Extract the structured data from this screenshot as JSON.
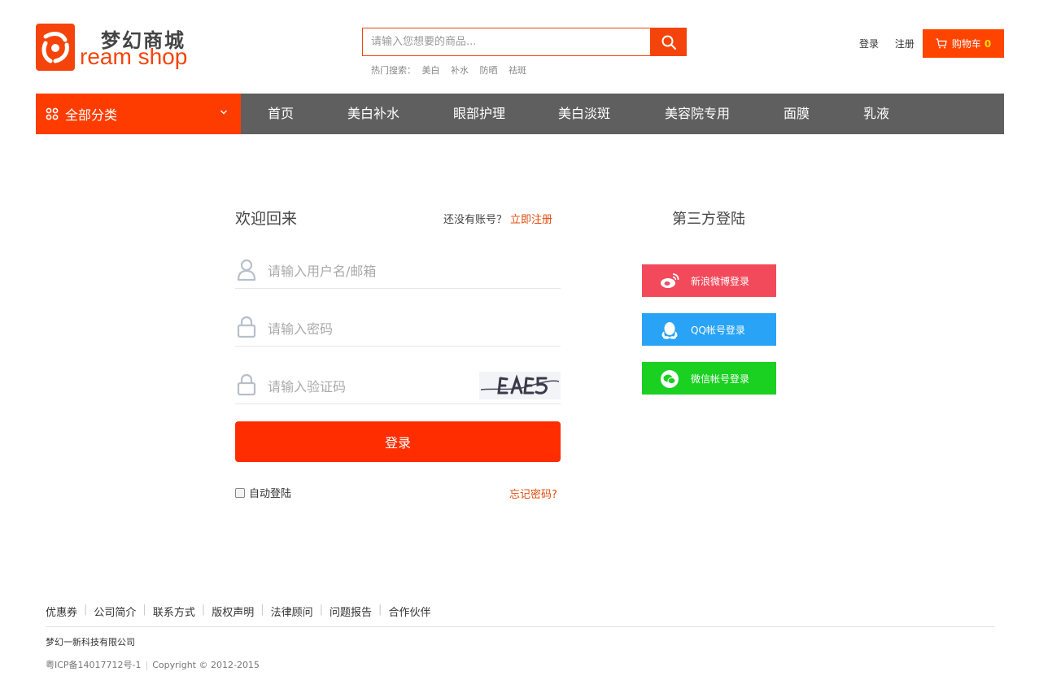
{
  "header": {
    "logo_cn": "梦幻商城",
    "logo_en": "ream shop",
    "search_placeholder": "请输入您想要的商品...",
    "hot_label": "热门搜索：",
    "hot_terms": [
      "美白",
      "补水",
      "防晒",
      "祛斑"
    ],
    "login_link": "登录",
    "register_link": "注册",
    "cart_label": "购物车",
    "cart_count": "0"
  },
  "nav": {
    "category_label": "全部分类",
    "items": [
      "首页",
      "美白补水",
      "眼部护理",
      "美白淡斑",
      "美容院专用",
      "面膜",
      "乳液"
    ]
  },
  "login": {
    "welcome": "欢迎回来",
    "no_account": "还没有账号？",
    "register_now": "立即注册",
    "username_placeholder": "请输入用户名/邮箱",
    "password_placeholder": "请输入密码",
    "captcha_placeholder": "请输入验证码",
    "submit": "登录",
    "auto_login": "自动登陆",
    "forgot": "忘记密码?"
  },
  "third_party": {
    "title": "第三方登陆",
    "weibo": "新浪微博登录",
    "qq": "QQ帐号登录",
    "wechat": "微信帐号登录"
  },
  "footer": {
    "links": [
      "优惠券",
      "公司简介",
      "联系方式",
      "版权声明",
      "法律顾问",
      "问题报告",
      "合作伙伴"
    ],
    "company": "梦幻一新科技有限公司",
    "icp": "粤ICP备14017712号-1",
    "copyright": "Copyright © 2012-2015"
  },
  "colors": {
    "brand": "#f5440b",
    "nav_bg": "#5f5f5f",
    "weibo": "#f24a5b",
    "qq": "#28a3f5",
    "wechat": "#1ad021"
  }
}
